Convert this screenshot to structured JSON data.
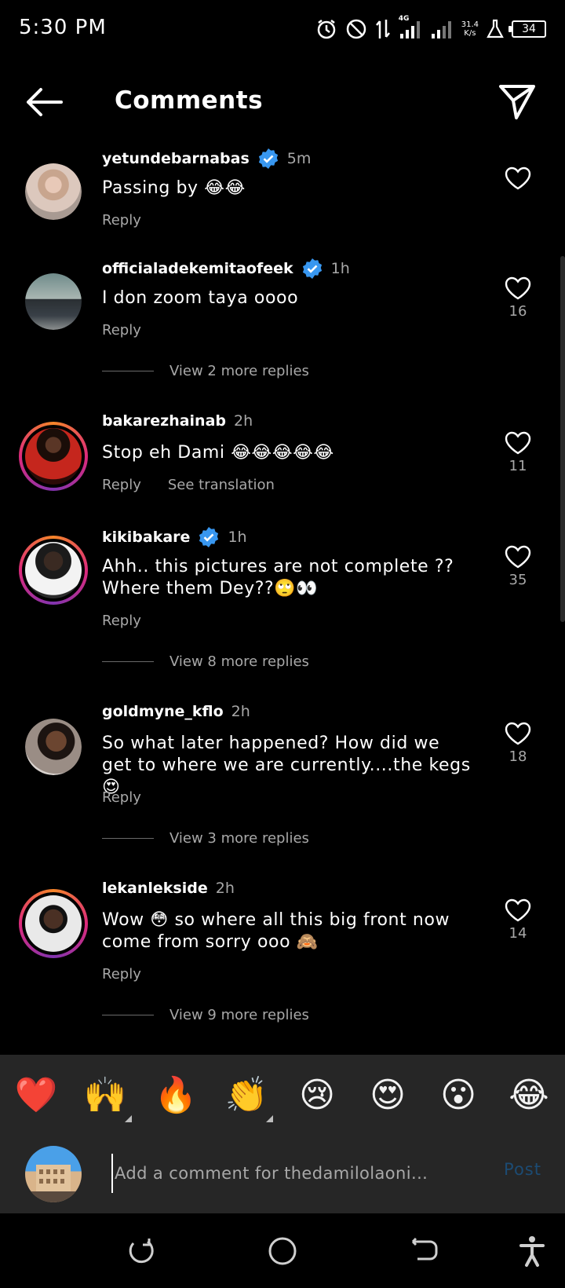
{
  "status_bar": {
    "time": "5:30 PM",
    "network": "4G",
    "speed_value": "31.4",
    "speed_unit": "K/s",
    "battery": "34"
  },
  "header": {
    "title": "Comments"
  },
  "comments": [
    {
      "username": "yetundebarnabas",
      "verified": true,
      "time": "5m",
      "text": "Passing by 😂😂",
      "reply_label": "Reply",
      "likes": "",
      "story_ring": false
    },
    {
      "username": "officialadekemitaofeek",
      "verified": true,
      "time": "1h",
      "text": "I don zoom taya oooo",
      "reply_label": "Reply",
      "likes": "16",
      "view_replies": "View 2 more replies",
      "story_ring": false
    },
    {
      "username": "bakarezhainab",
      "verified": false,
      "time": "2h",
      "text": "Stop eh Dami 😂😂😂😂😂",
      "reply_label": "Reply",
      "translation_label": "See translation",
      "likes": "11",
      "story_ring": true
    },
    {
      "username": "kikibakare",
      "verified": true,
      "time": "1h",
      "text": "Ahh.. this pictures are not complete ?? Where them Dey??🙄👀",
      "reply_label": "Reply",
      "likes": "35",
      "view_replies": "View 8 more replies",
      "story_ring": true
    },
    {
      "username": "goldmyne_kflo",
      "verified": false,
      "time": "2h",
      "text": "So what later happened? How did we get to where we are currently....the kegs😍",
      "reply_label": "Reply",
      "likes": "18",
      "view_replies": "View 3 more replies",
      "story_ring": false
    },
    {
      "username": "lekanlekside",
      "verified": false,
      "time": "2h",
      "text": "Wow 😳 so where all this big front now come from sorry ooo 🙈",
      "reply_label": "Reply",
      "likes": "14",
      "view_replies": "View 9 more replies",
      "story_ring": true
    }
  ],
  "emoji_bar": [
    "❤️",
    "🙌",
    "🔥",
    "👏",
    "😢",
    "😍",
    "😮",
    "😂"
  ],
  "comment_input": {
    "placeholder": "Add a comment for thedamilolaoni...",
    "post_label": "Post"
  },
  "colors": {
    "background": "#000000",
    "panel": "#262626",
    "verified_blue": "#3897f0",
    "secondary_text": "#a8a8a8",
    "post_disabled": "#1c4b73"
  }
}
